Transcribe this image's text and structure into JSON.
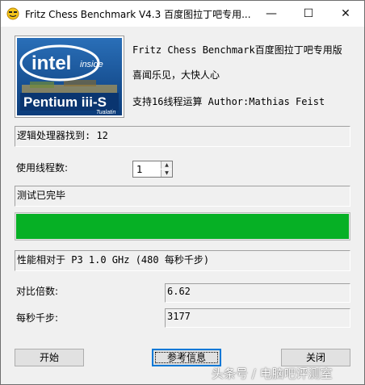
{
  "window": {
    "title": "Fritz Chess Benchmark V4.3  百度图拉丁吧专用...",
    "minimize_glyph": "—",
    "maximize_glyph": "☐",
    "close_glyph": "✕"
  },
  "logo": {
    "brand": "intel",
    "tagline": "inside",
    "product": "Pentium iii-S",
    "codename": "Tualatin"
  },
  "info": {
    "line1": "Fritz Chess Benchmark百度图拉丁吧专用版",
    "line2": "喜闻乐见，大快人心",
    "line3": "支持16线程运算   Author:Mathias Feist"
  },
  "processors": {
    "text": "逻辑处理器找到: 12"
  },
  "threads": {
    "label": "使用线程数:",
    "value": "1"
  },
  "status": {
    "text": "测试已完毕"
  },
  "progress": {
    "percent": 100,
    "color": "#06b025"
  },
  "relative": {
    "text": "性能相对于 P3 1.0 GHz (480 每秒千步)"
  },
  "ratio": {
    "label": "对比倍数:",
    "value": "6.62"
  },
  "kn_per_sec": {
    "label": "每秒千步:",
    "value": "3177"
  },
  "buttons": {
    "start": "开始",
    "info": "参考信息",
    "close": "关闭"
  },
  "watermark": "头条号 / 电脑吧评测室"
}
